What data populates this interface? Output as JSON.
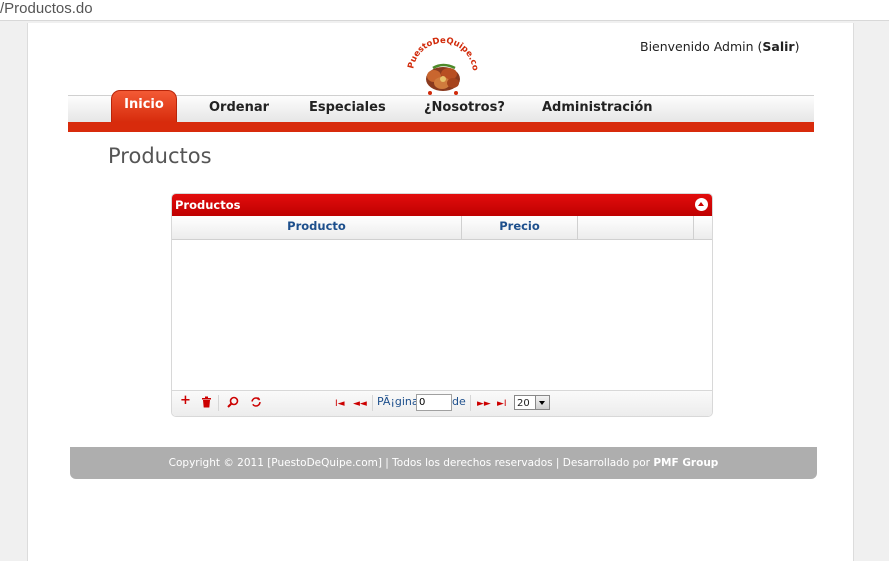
{
  "browser": {
    "url_text": "/Productos.do"
  },
  "header": {
    "welcome_prefix": "Bienvenido Admin (",
    "logout_label": "Salir",
    "welcome_suffix": ")",
    "logo_text": "PuestoDeQuipe.com"
  },
  "nav": {
    "items": [
      {
        "label": "Inicio"
      },
      {
        "label": "Ordenar"
      },
      {
        "label": "Especiales"
      },
      {
        "label": "¿Nosotros?"
      },
      {
        "label": "Administración"
      }
    ],
    "active_index": 0
  },
  "page": {
    "title": "Productos"
  },
  "grid": {
    "caption": "Productos",
    "columns": [
      "Producto",
      "Precio",
      ""
    ],
    "rows": [],
    "pager": {
      "page_label": "PÃ¡gina",
      "page_value": "0",
      "of_label": "de",
      "page_size": "20"
    }
  },
  "footer": {
    "text": "Copyright © 2011 [PuestoDeQuipe.com] | Todos los derechos reservados | Desarrollado por ",
    "company": "PMF Group"
  },
  "colors": {
    "accent_red": "#d82b0c",
    "grid_header_red": "#cc0000",
    "link_blue": "#1d4f8c",
    "footer_gray": "#aeaeae"
  }
}
